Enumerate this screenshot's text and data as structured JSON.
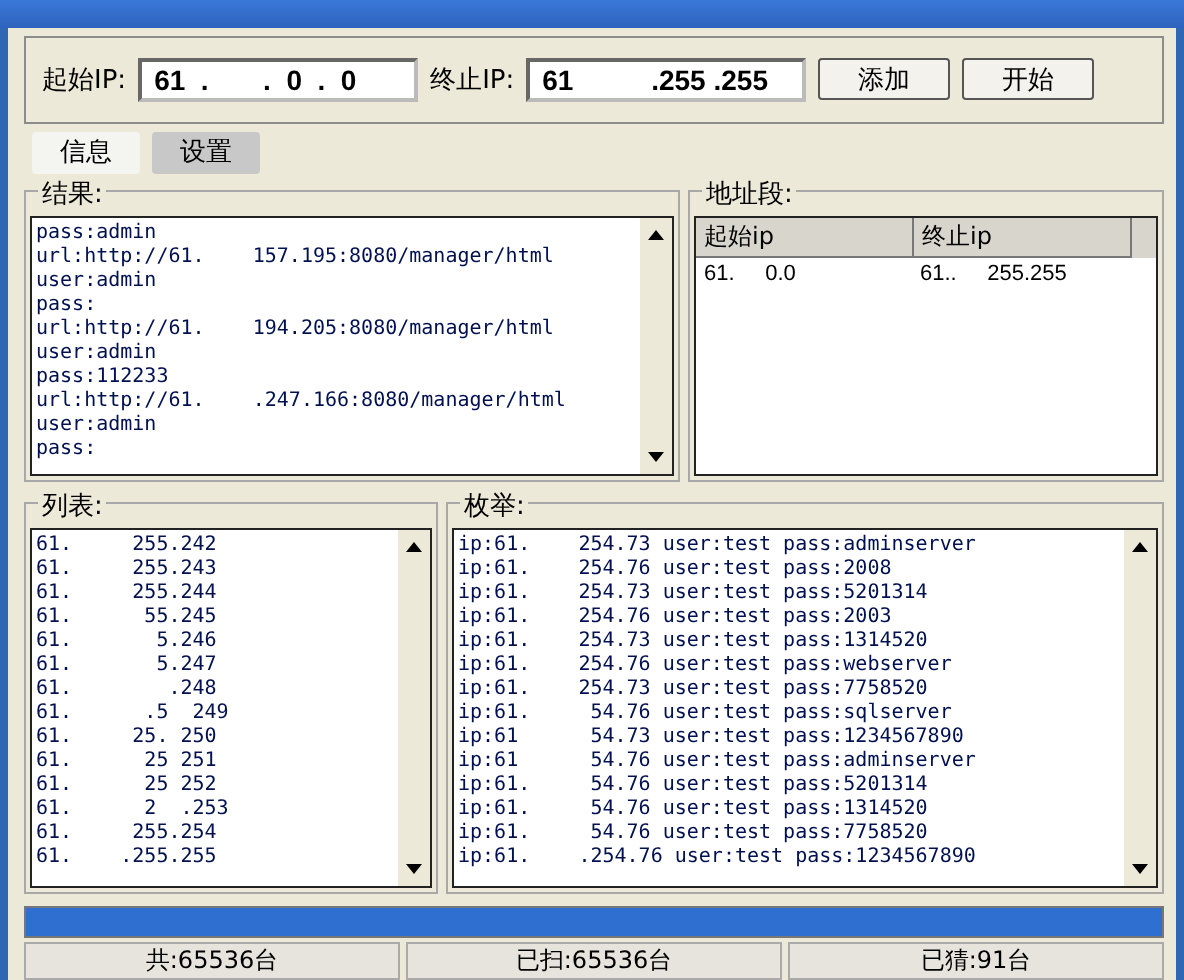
{
  "ip_range": {
    "start_label": "起始IP:",
    "start": "61  .       .  0  .  0",
    "end_label": "终止IP:",
    "end": "61          .255 .255",
    "buttons": [
      "添加",
      "开始"
    ]
  },
  "tabs": [
    {
      "label": "信息",
      "selected": true
    },
    {
      "label": "设置",
      "selected": false
    }
  ],
  "results": {
    "title": "结果:",
    "lines": [
      "pass:admin",
      "url:http://61.    157.195:8080/manager/html",
      "user:admin",
      "pass:",
      "url:http://61.    194.205:8080/manager/html",
      "user:admin",
      "pass:112233",
      "url:http://61.    .247.166:8080/manager/html",
      "user:admin",
      "pass:"
    ]
  },
  "segments": {
    "title": "地址段:",
    "columns": [
      "起始ip",
      "终止ip"
    ],
    "rows": [
      [
        "61.     0.0",
        "61..     255.255"
      ]
    ]
  },
  "list": {
    "title": "列表:",
    "items": [
      "61.     255.242",
      "61.     255.243",
      "61.     255.244",
      "61.      55.245",
      "61.       5.246",
      "61.       5.247",
      "61.        .248",
      "61.      .5  249",
      "61.     25. 250",
      "61.      25 251",
      "61.      25 252",
      "61.      2  .253",
      "61.     255.254",
      "61.    .255.255"
    ]
  },
  "enumeration": {
    "title": "枚举:",
    "items": [
      "ip:61.    254.73 user:test pass:adminserver",
      "ip:61.    254.76 user:test pass:2008",
      "ip:61.    254.73 user:test pass:5201314",
      "ip:61.    254.76 user:test pass:2003",
      "ip:61.    254.73 user:test pass:1314520",
      "ip:61.    254.76 user:test pass:webserver",
      "ip:61.    254.73 user:test pass:7758520",
      "ip:61.     54.76 user:test pass:sqlserver",
      "ip:61      54.73 user:test pass:1234567890",
      "ip:61      54.76 user:test pass:adminserver",
      "ip:61.     54.76 user:test pass:5201314",
      "ip:61.     54.76 user:test pass:1314520",
      "ip:61.     54.76 user:test pass:7758520",
      "ip:61.    .254.76 user:test pass:1234567890"
    ]
  },
  "progress": {
    "level": 1
  },
  "status_bar": [
    "共:65536台",
    "已扫:65536台",
    "已猜:91台"
  ]
}
